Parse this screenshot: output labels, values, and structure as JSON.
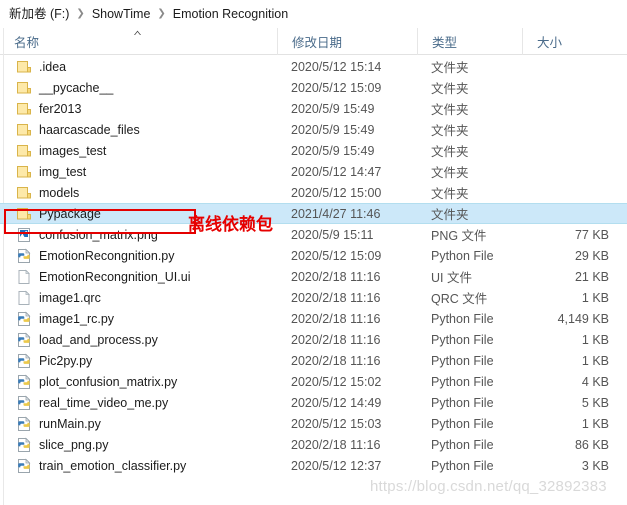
{
  "breadcrumb": {
    "items": [
      "新加卷 (F:)",
      "ShowTime",
      "Emotion Recognition"
    ],
    "separator": "❯"
  },
  "columns": {
    "name": "名称",
    "date": "修改日期",
    "type": "类型",
    "size": "大小",
    "sort_icon": "sort-ascending-icon",
    "sort_direction": "ascending"
  },
  "annotation": {
    "text": "离线依赖包",
    "color": "#e60000",
    "target_row": "Pypackage"
  },
  "watermark": "https://blog.csdn.net/qq_32892383",
  "selection": {
    "color": "#cce8f9",
    "selected_name": "Pypackage"
  },
  "rows": [
    {
      "name": ".idea",
      "date": "2020/5/12 15:14",
      "type": "文件夹",
      "size": "",
      "icon": "folder-icon",
      "selected": false
    },
    {
      "name": "__pycache__",
      "date": "2020/5/12 15:09",
      "type": "文件夹",
      "size": "",
      "icon": "folder-icon",
      "selected": false
    },
    {
      "name": "fer2013",
      "date": "2020/5/9 15:49",
      "type": "文件夹",
      "size": "",
      "icon": "folder-icon",
      "selected": false
    },
    {
      "name": "haarcascade_files",
      "date": "2020/5/9 15:49",
      "type": "文件夹",
      "size": "",
      "icon": "folder-icon",
      "selected": false
    },
    {
      "name": "images_test",
      "date": "2020/5/9 15:49",
      "type": "文件夹",
      "size": "",
      "icon": "folder-icon",
      "selected": false
    },
    {
      "name": "img_test",
      "date": "2020/5/12 14:47",
      "type": "文件夹",
      "size": "",
      "icon": "folder-icon",
      "selected": false
    },
    {
      "name": "models",
      "date": "2020/5/12 15:00",
      "type": "文件夹",
      "size": "",
      "icon": "folder-icon",
      "selected": false
    },
    {
      "name": "Pypackage",
      "date": "2021/4/27 11:46",
      "type": "文件夹",
      "size": "",
      "icon": "folder-icon",
      "selected": true
    },
    {
      "name": "confusion_matrix.png",
      "date": "2020/5/9 15:11",
      "type": "PNG 文件",
      "size": "77 KB",
      "icon": "png-image-icon",
      "selected": false
    },
    {
      "name": "EmotionRecongnition.py",
      "date": "2020/5/12 15:09",
      "type": "Python File",
      "size": "29 KB",
      "icon": "python-file-icon",
      "selected": false
    },
    {
      "name": "EmotionRecongnition_UI.ui",
      "date": "2020/2/18 11:16",
      "type": "UI 文件",
      "size": "21 KB",
      "icon": "generic-file-icon",
      "selected": false
    },
    {
      "name": "image1.qrc",
      "date": "2020/2/18 11:16",
      "type": "QRC 文件",
      "size": "1 KB",
      "icon": "generic-file-icon",
      "selected": false
    },
    {
      "name": "image1_rc.py",
      "date": "2020/2/18 11:16",
      "type": "Python File",
      "size": "4,149 KB",
      "icon": "python-file-icon",
      "selected": false
    },
    {
      "name": "load_and_process.py",
      "date": "2020/2/18 11:16",
      "type": "Python File",
      "size": "1 KB",
      "icon": "python-file-icon",
      "selected": false
    },
    {
      "name": "Pic2py.py",
      "date": "2020/2/18 11:16",
      "type": "Python File",
      "size": "1 KB",
      "icon": "python-file-icon",
      "selected": false
    },
    {
      "name": "plot_confusion_matrix.py",
      "date": "2020/5/12 15:02",
      "type": "Python File",
      "size": "4 KB",
      "icon": "python-file-icon",
      "selected": false
    },
    {
      "name": "real_time_video_me.py",
      "date": "2020/5/12 14:49",
      "type": "Python File",
      "size": "5 KB",
      "icon": "python-file-icon",
      "selected": false
    },
    {
      "name": "runMain.py",
      "date": "2020/5/12 15:03",
      "type": "Python File",
      "size": "1 KB",
      "icon": "python-file-icon",
      "selected": false
    },
    {
      "name": "slice_png.py",
      "date": "2020/2/18 11:16",
      "type": "Python File",
      "size": "86 KB",
      "icon": "python-file-icon",
      "selected": false
    },
    {
      "name": "train_emotion_classifier.py",
      "date": "2020/5/12 12:37",
      "type": "Python File",
      "size": "3 KB",
      "icon": "python-file-icon",
      "selected": false
    }
  ]
}
